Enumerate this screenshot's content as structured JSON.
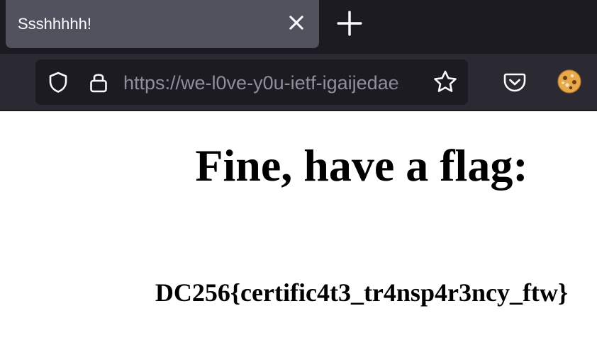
{
  "browser": {
    "tab": {
      "title": "Ssshhhhh!",
      "close_icon": "close-icon"
    },
    "new_tab_icon": "plus-icon",
    "address_bar": {
      "url": "https://we-l0ve-y0u-ietf-igaijedae",
      "icons": [
        "shield-icon",
        "lock-icon",
        "star-icon"
      ]
    },
    "toolbar_icons": [
      "pocket-icon",
      "account-avatar"
    ]
  },
  "page": {
    "heading": "Fine, have a flag:",
    "flag": "DC256{certific4t3_tr4nsp4r3ncy_ftw}"
  },
  "colors": {
    "tabbar_bg": "#1c1b22",
    "active_tab_bg": "#52525e",
    "navbar_bg": "#2b2a33",
    "urlbar_bg": "#1c1b22",
    "icon": "#fbfbfe",
    "url_text": "#8f8f9d"
  }
}
